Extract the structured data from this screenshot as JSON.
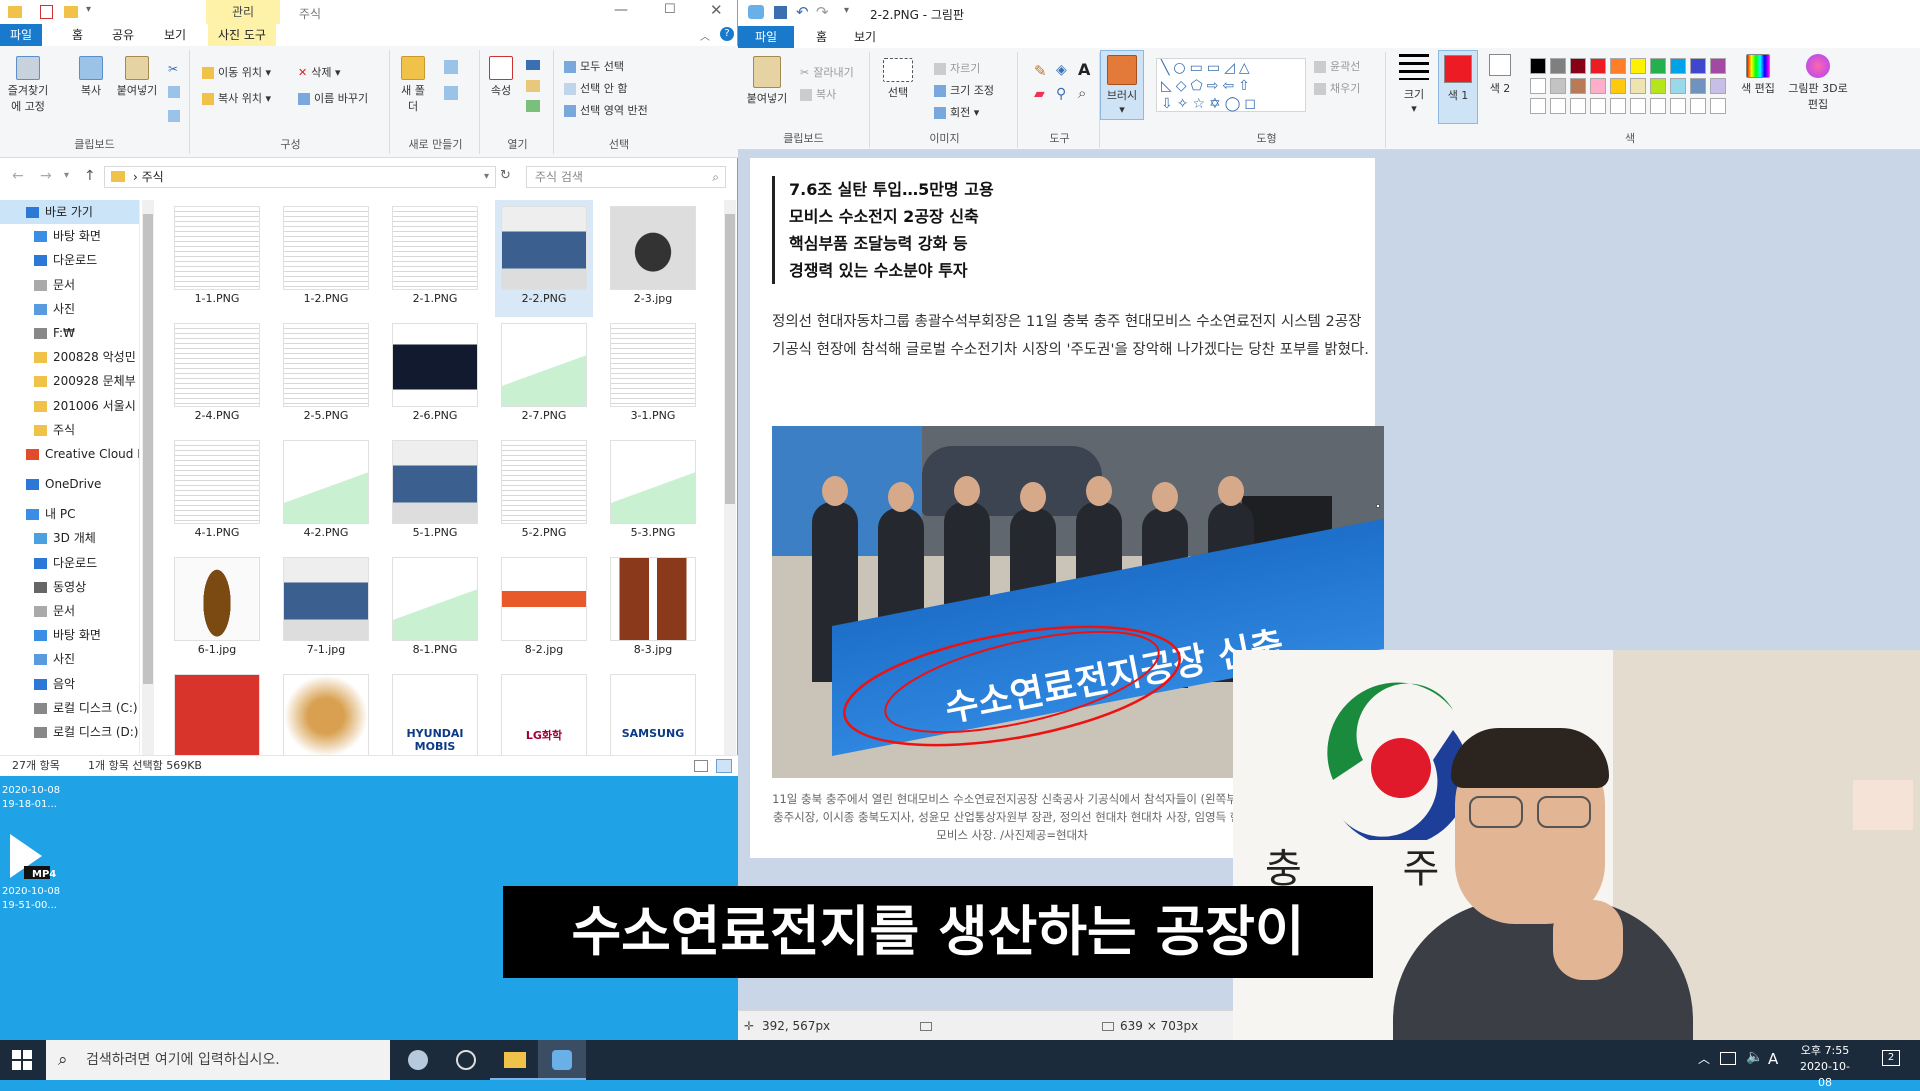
{
  "explorer": {
    "context_group": "관리",
    "window_title": "주식",
    "tabs": [
      "파일",
      "홈",
      "공유",
      "보기",
      "사진 도구"
    ],
    "ribbon": {
      "clipboard": {
        "pin": "즐겨찾기에 고정",
        "copy": "복사",
        "paste": "붙여넣기",
        "label": "클립보드"
      },
      "organize": {
        "move_to": "이동 위치",
        "copy_to": "복사 위치",
        "delete": "삭제",
        "rename": "이름 바꾸기",
        "label": "구성"
      },
      "new": {
        "new_folder": "새 폴더",
        "label": "새로 만들기"
      },
      "open": {
        "properties": "속성",
        "label": "열기"
      },
      "select": {
        "select_all": "모두 선택",
        "select_none": "선택 안 함",
        "invert": "선택 영역 반전",
        "label": "선택"
      }
    },
    "address": "주식",
    "search_placeholder": "주식 검색",
    "nav": [
      {
        "label": "바로 가기",
        "color": "#2b78d8"
      },
      {
        "label": "바탕 화면",
        "color": "#3a8ee6"
      },
      {
        "label": "다운로드",
        "color": "#2b78d8"
      },
      {
        "label": "문서",
        "color": "#aaaaaa"
      },
      {
        "label": "사진",
        "color": "#5a9be0"
      },
      {
        "label": "F:₩",
        "color": "#888888"
      },
      {
        "label": "200828 악성민",
        "color": "#f0c24a"
      },
      {
        "label": "200928 문체부",
        "color": "#f0c24a"
      },
      {
        "label": "201006 서울시",
        "color": "#f0c24a"
      },
      {
        "label": "주식",
        "color": "#f0c24a"
      },
      {
        "label": "Creative Cloud Fil",
        "color": "#e34b2a"
      },
      {
        "label": "OneDrive",
        "color": "#2b78d8"
      },
      {
        "label": "내 PC",
        "color": "#3a8ee6"
      },
      {
        "label": "3D 개체",
        "color": "#4aa0e0"
      },
      {
        "label": "다운로드",
        "color": "#2b78d8"
      },
      {
        "label": "동영상",
        "color": "#666666"
      },
      {
        "label": "문서",
        "color": "#aaaaaa"
      },
      {
        "label": "바탕 화면",
        "color": "#3a8ee6"
      },
      {
        "label": "사진",
        "color": "#5a9be0"
      },
      {
        "label": "음악",
        "color": "#2b78d8"
      },
      {
        "label": "로컬 디스크 (C:)",
        "color": "#888888"
      },
      {
        "label": "로컬 디스크 (D:)",
        "color": "#888888"
      }
    ],
    "files": [
      {
        "name": "1-1.PNG",
        "kind": "doc"
      },
      {
        "name": "1-2.PNG",
        "kind": "doc"
      },
      {
        "name": "2-1.PNG",
        "kind": "doc"
      },
      {
        "name": "2-2.PNG",
        "kind": "photo",
        "selected": true
      },
      {
        "name": "2-3.jpg",
        "kind": "car"
      },
      {
        "name": "2-4.PNG",
        "kind": "doc"
      },
      {
        "name": "2-5.PNG",
        "kind": "doc"
      },
      {
        "name": "2-6.PNG",
        "kind": "dark"
      },
      {
        "name": "2-7.PNG",
        "kind": "chart"
      },
      {
        "name": "3-1.PNG",
        "kind": "doc"
      },
      {
        "name": "4-1.PNG",
        "kind": "doc"
      },
      {
        "name": "4-2.PNG",
        "kind": "chart"
      },
      {
        "name": "5-1.PNG",
        "kind": "photo"
      },
      {
        "name": "5-2.PNG",
        "kind": "doc"
      },
      {
        "name": "5-3.PNG",
        "kind": "chart"
      },
      {
        "name": "6-1.jpg",
        "kind": "bottle"
      },
      {
        "name": "7-1.jpg",
        "kind": "photo"
      },
      {
        "name": "8-1.PNG",
        "kind": "chart"
      },
      {
        "name": "8-2.jpg",
        "kind": "tube"
      },
      {
        "name": "8-3.jpg",
        "kind": "bottles"
      },
      {
        "name": "",
        "kind": "snack"
      },
      {
        "name": "",
        "kind": "food"
      },
      {
        "name": "",
        "kind": "logo",
        "logo": "HYUNDAI MOBIS"
      },
      {
        "name": "",
        "kind": "logo",
        "logo": "LG화학"
      },
      {
        "name": "",
        "kind": "logo",
        "logo": "SAMSUNG"
      }
    ],
    "status": {
      "count": "27개 항목",
      "selection": "1개 항목 선택함 569KB"
    }
  },
  "desktop": {
    "items": [
      {
        "date": "2020-10-08",
        "time": "19-18-01..."
      },
      {
        "badge": "MP4",
        "date": "2020-10-08",
        "time": "19-51-00..."
      }
    ]
  },
  "paint": {
    "title": "2-2.PNG - 그림판",
    "tabs": [
      "파일",
      "홈",
      "보기"
    ],
    "ribbon": {
      "clipboard": {
        "paste": "붙여넣기",
        "cut": "잘라내기",
        "copy": "복사",
        "label": "클립보드"
      },
      "image": {
        "select": "선택",
        "crop": "자르기",
        "resize": "크기 조정",
        "rotate": "회전",
        "label": "이미지"
      },
      "tools": {
        "label": "도구"
      },
      "brush": "브러시",
      "shapes": {
        "outline": "윤곽선",
        "fill": "채우기",
        "label": "도형"
      },
      "size": "크기",
      "color1": "색 1",
      "color2": "색 2",
      "edit_colors": "색 편집",
      "paint3d": "그림판 3D로 편집",
      "colors_label": "색",
      "palette": [
        "#000000",
        "#7f7f7f",
        "#880015",
        "#ed1c24",
        "#ff7f27",
        "#fff200",
        "#22b14c",
        "#00a2e8",
        "#3f48cc",
        "#a349a4",
        "#ffffff",
        "#c3c3c3",
        "#b97a57",
        "#ffaec9",
        "#ffc90e",
        "#efe4b0",
        "#b5e61d",
        "#99d9ea",
        "#7092be",
        "#c8bfe7"
      ],
      "color1_value": "#ed1c24",
      "color2_value": "#ffffff"
    },
    "article": {
      "headlines": [
        "7.6조 실탄 투입…5만명 고용",
        "모비스 수소전지 2공장 신축",
        "핵심부품 조달능력 강화 등",
        "경쟁력 있는 수소분야 투자"
      ],
      "paragraph": "정의선 현대자동차그룹 총괄수석부회장은 11일 충북 충주 현대모비스 수소연료전지 시스템 2공장 기공식 현장에 참석해 글로벌 수소전기차 시장의 '주도권'을 장악해 나가겠다는 당찬 포부를 밝혔다.",
      "banner": "수소연료전지공장 신축",
      "caption": "11일 충북 충주에서 열린 현대모비스 수소연료전지공장 신축공사 기공식에서 참석자들이 (왼쪽부터) 충주시장, 이시종 충북도지사, 성윤모 산업통상자원부 장관, 정의선 현대차 현대차 사장, 임영득 현대모비스 사장. /사진제공=현대차"
    },
    "status": {
      "cursor": "392, 567px",
      "size": "639 × 703px"
    }
  },
  "webcam": {
    "backdrop_text": "충 주 시"
  },
  "subtitle": "수소연료전지를 생산하는 공장이",
  "taskbar": {
    "search_placeholder": "검색하려면 여기에 입력하십시오.",
    "ime": "A",
    "time": "오후 7:55",
    "date": "2020-10-08",
    "notifications": "2"
  }
}
